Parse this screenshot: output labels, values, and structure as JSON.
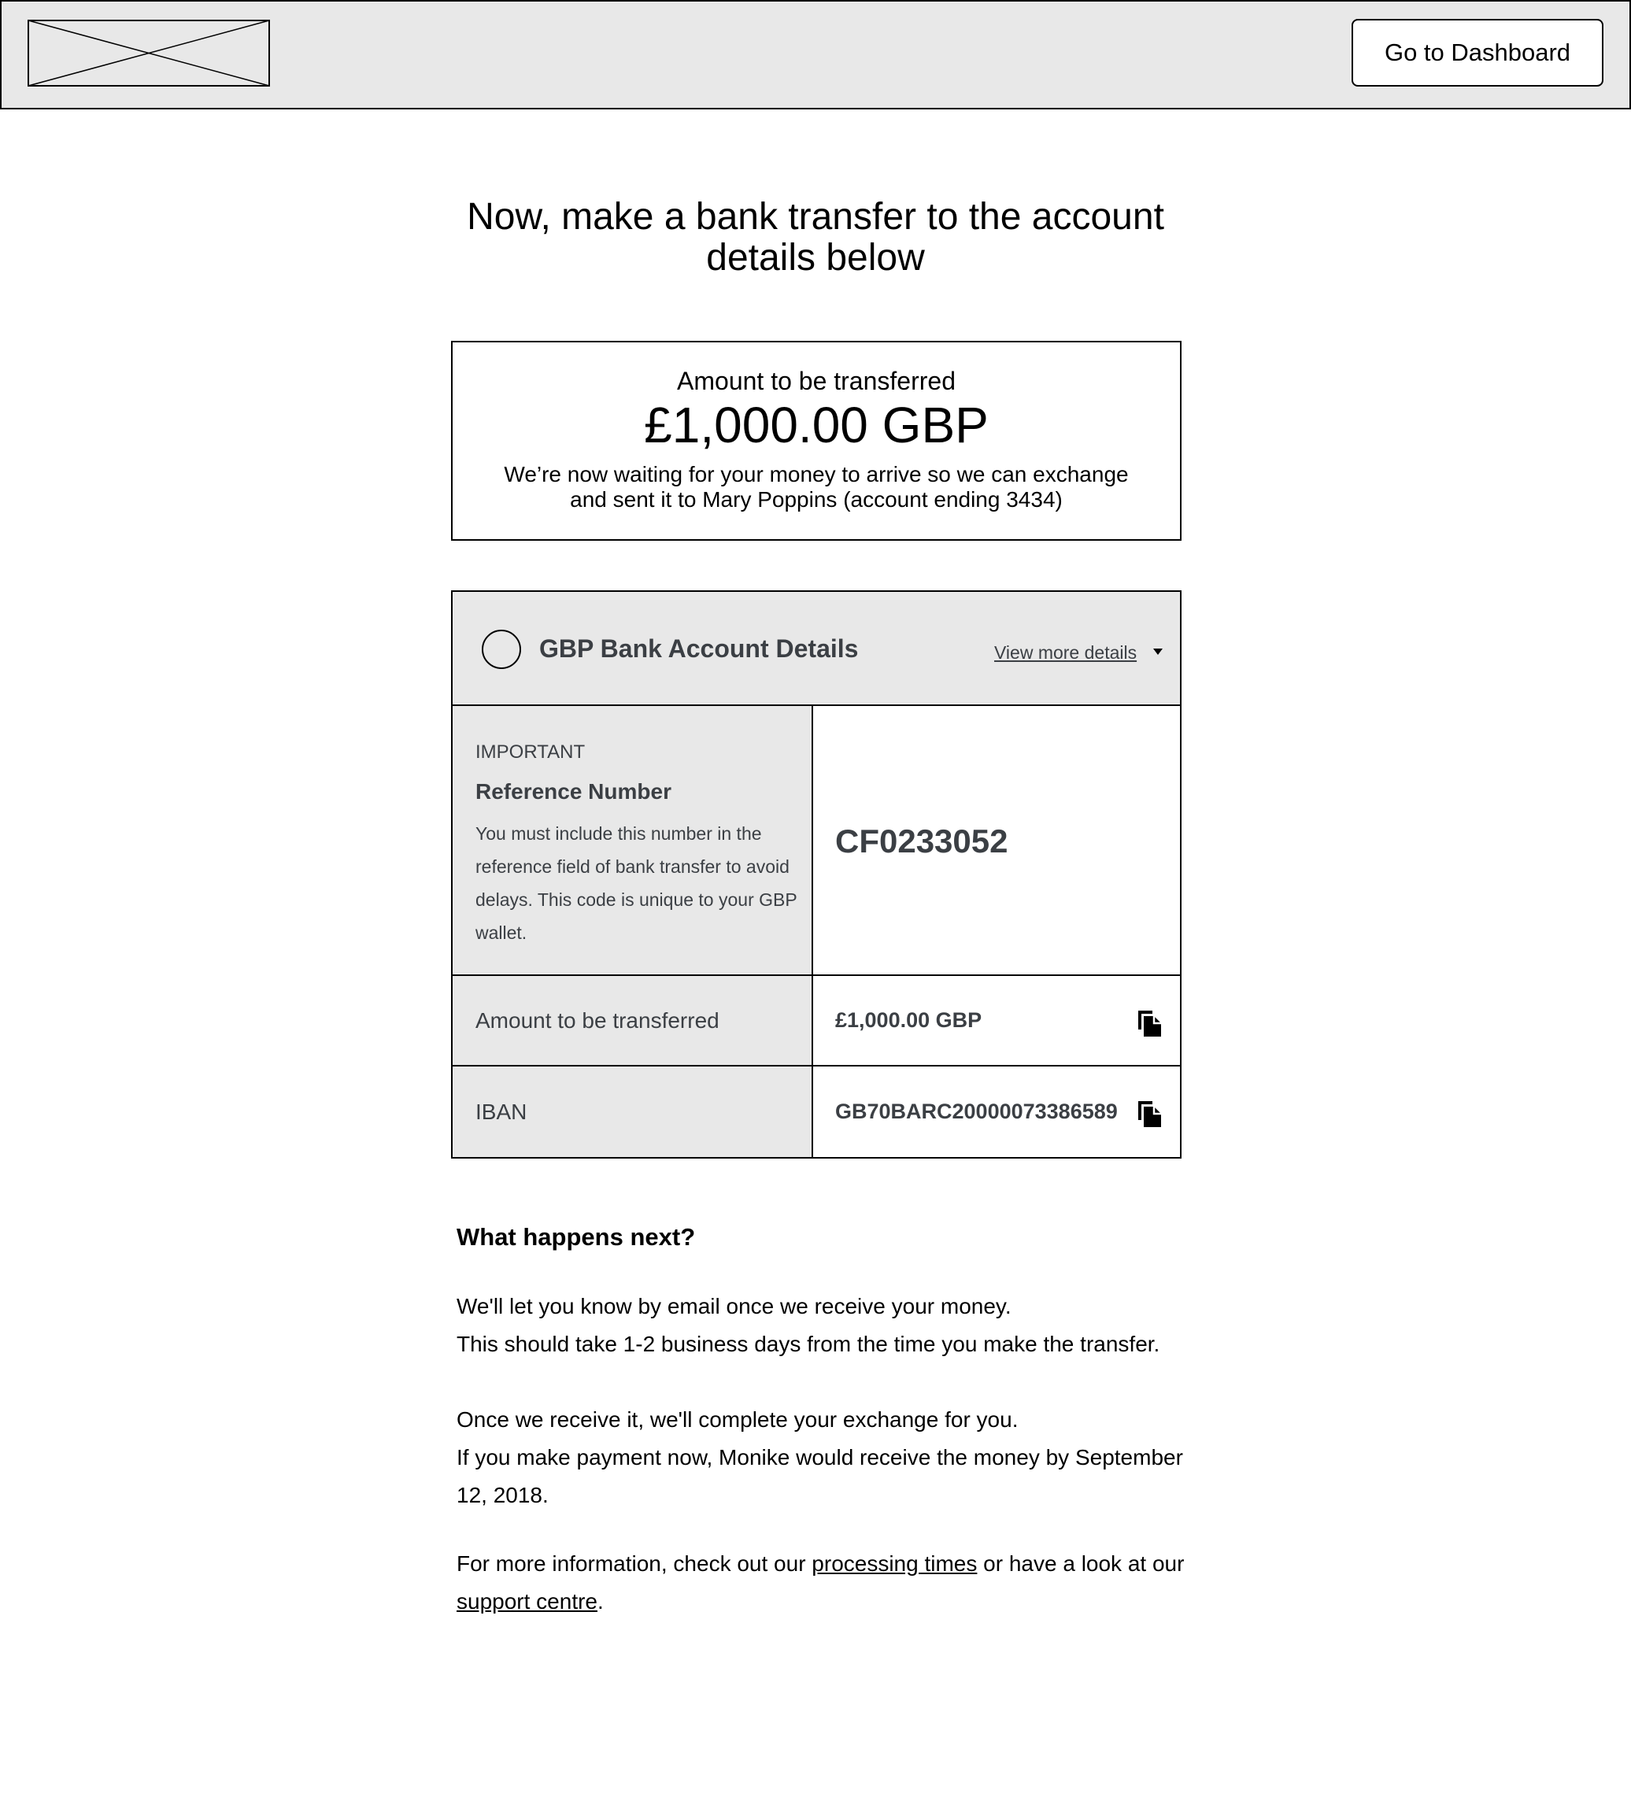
{
  "header": {
    "logo_icon": "logo-placeholder-icon",
    "dashboard_button_label": "Go to Dashboard"
  },
  "page": {
    "title": "Now, make a bank transfer to the account details below"
  },
  "amount_card": {
    "label": "Amount to be transferred",
    "amount": "£1,000.00 GBP",
    "description": "We’re now waiting for your money to arrive so we can exchange and sent it to Mary Poppins (account ending 3434)"
  },
  "bank_details": {
    "title": "GBP Bank Account Details",
    "view_more_label": "View more details",
    "reference": {
      "important_label": "IMPORTANT",
      "title": "Reference Number",
      "description": "You must include this number in the reference field of bank transfer to avoid delays. This code is unique to your GBP wallet.",
      "value": "CF0233052"
    },
    "amount_row": {
      "label": "Amount to be transferred",
      "value": "£1,000.00 GBP",
      "icon": "copy-icon"
    },
    "iban_row": {
      "label": "IBAN",
      "value": "GB70BARC20000073386589",
      "icon": "copy-icon"
    }
  },
  "next_steps": {
    "heading": "What happens next?",
    "paragraph1_line1": "We'll let you know by email once we receive your money.",
    "paragraph1_line2": "This should take 1-2 business days from the time you make the transfer.",
    "paragraph2_line1": "Once we receive it, we'll complete your exchange for you.",
    "paragraph2_line2": "If you make payment now, Monike would receive the money by September 12, 2018.",
    "paragraph3_prefix": "For more information, check out our ",
    "processing_times_link": "processing times",
    "paragraph3_middle": " or have a look at our ",
    "support_centre_link": "support centre",
    "paragraph3_suffix": "."
  },
  "colors": {
    "header_bg": "#e8e8e8",
    "label_text": "#3b3f44",
    "border": "#000000"
  }
}
